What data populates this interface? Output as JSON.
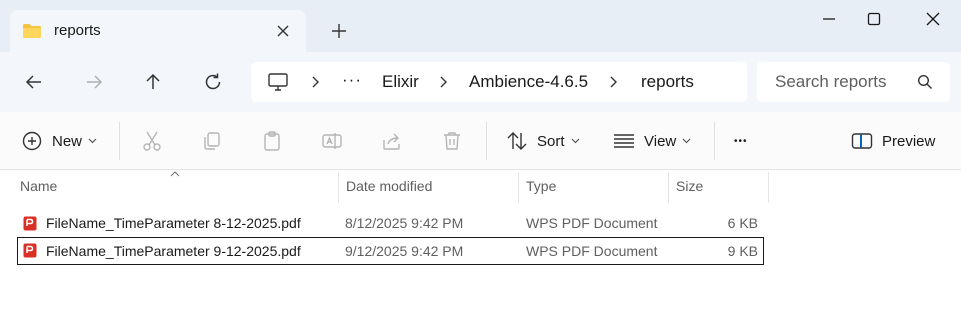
{
  "window": {
    "tab_title": "reports"
  },
  "address": {
    "overflow": "···",
    "crumbs": [
      "Elixir",
      "Ambience-4.6.5",
      "reports"
    ]
  },
  "search": {
    "placeholder": "Search reports"
  },
  "toolbar": {
    "new_label": "New",
    "sort_label": "Sort",
    "view_label": "View",
    "more_label": "•••",
    "preview_label": "Preview"
  },
  "columns": {
    "name": "Name",
    "date": "Date modified",
    "type": "Type",
    "size": "Size"
  },
  "files": [
    {
      "name": "FileName_TimeParameter 8-12-2025.pdf",
      "date": "8/12/2025 9:42 PM",
      "type": "WPS PDF Document",
      "size": "6 KB",
      "selected": false
    },
    {
      "name": "FileName_TimeParameter 9-12-2025.pdf",
      "date": "9/12/2025 9:42 PM",
      "type": "WPS PDF Document",
      "size": "9 KB",
      "selected": true
    }
  ],
  "colors": {
    "titlebar_bg": "#e8eef6",
    "folder": "#f4c542",
    "pdf": "#d93025",
    "accent": "#0067c0"
  }
}
